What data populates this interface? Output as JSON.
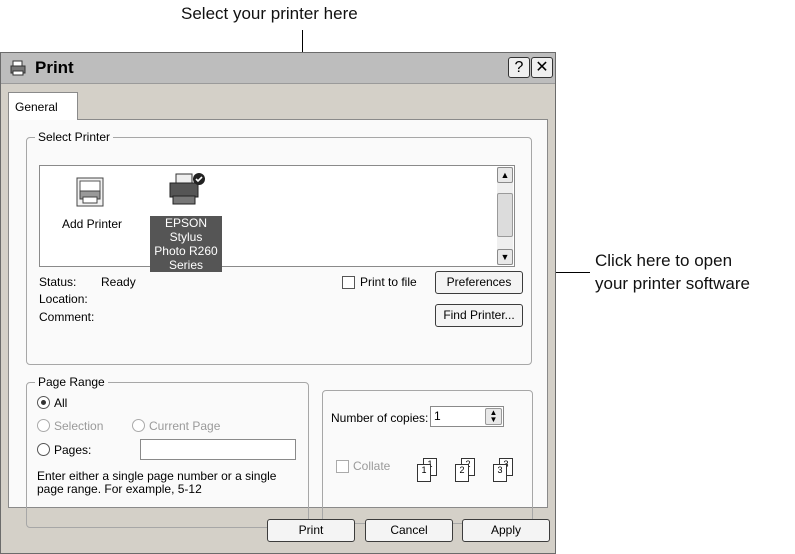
{
  "callouts": {
    "top": "Select your printer here",
    "right_line1": "Click here to open",
    "right_line2": "your printer software"
  },
  "window": {
    "title": "Print",
    "help_button": "?",
    "close_button": "✕"
  },
  "tabs": [
    {
      "label": "General"
    }
  ],
  "select_printer": {
    "legend": "Select Printer",
    "items": [
      {
        "label": "Add Printer",
        "icon": "add-printer-icon"
      },
      {
        "label_line1": "EPSON Stylus",
        "label_line2": "Photo R260",
        "label_line3": "Series",
        "icon": "printer-icon",
        "selected": true
      }
    ],
    "status_label": "Status:",
    "status_value": "Ready",
    "location_label": "Location:",
    "location_value": "",
    "comment_label": "Comment:",
    "comment_value": "",
    "print_to_file_label": "Print to file",
    "print_to_file_checked": false,
    "preferences_button": "Preferences",
    "find_printer_button": "Find Printer..."
  },
  "page_range": {
    "legend": "Page Range",
    "all_label": "All",
    "selection_label": "Selection",
    "current_page_label": "Current Page",
    "pages_label": "Pages:",
    "pages_value": "",
    "selected_option": "All",
    "help_line1": "Enter either a single page number or a single",
    "help_line2": "page range.  For example, 5-12"
  },
  "copies": {
    "number_label": "Number of copies:",
    "number_value": "1",
    "collate_label": "Collate",
    "collate_checked": false,
    "page_numbers": [
      "1",
      "1",
      "2",
      "2",
      "3",
      "3"
    ]
  },
  "footer": {
    "print_button": "Print",
    "cancel_button": "Cancel",
    "apply_button": "Apply"
  }
}
